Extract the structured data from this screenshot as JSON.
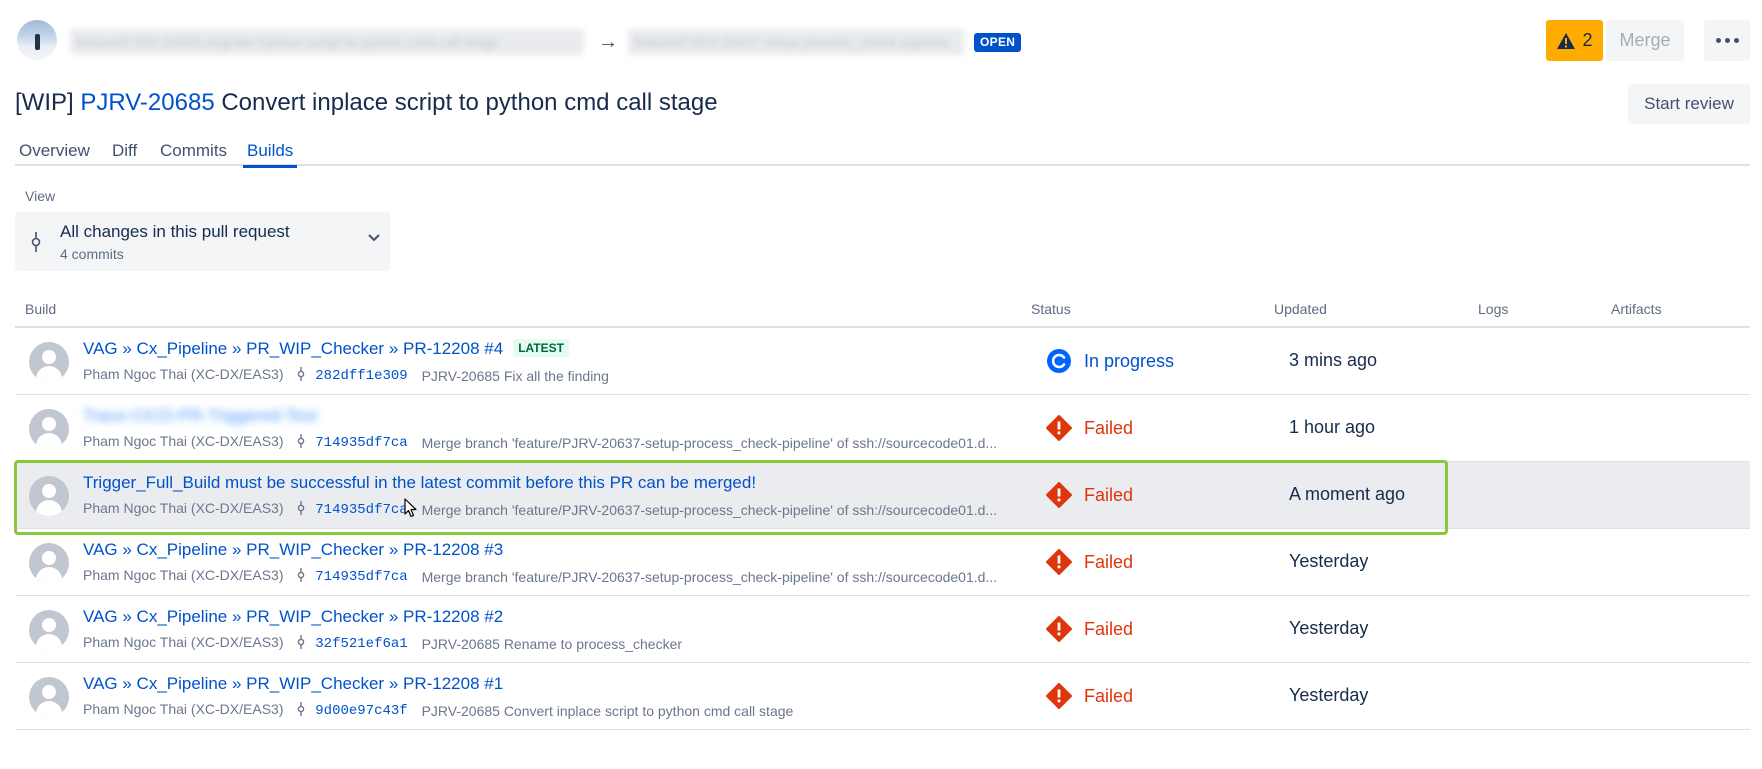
{
  "header": {
    "source_branch": "feature/PJRV-20685-migrate-inplace-script-to-python-cmd-call-stage",
    "dest_branch": "feature/PJRV-20637-setup-process_check-pipeline",
    "arrow": "→",
    "state_badge": "OPEN",
    "warning_count": "2",
    "merge_label": "Merge",
    "more_label": "•••"
  },
  "pr": {
    "prefix": "[WIP]",
    "issue_key": "PJRV-20685",
    "title": "Convert inplace script to python cmd call stage",
    "start_review_label": "Start review"
  },
  "tabs": [
    {
      "label": "Overview"
    },
    {
      "label": "Diff"
    },
    {
      "label": "Commits"
    },
    {
      "label": "Builds"
    }
  ],
  "view": {
    "label": "View",
    "selected": "All changes in this pull request",
    "subtext": "4 commits"
  },
  "table": {
    "columns": [
      "Build",
      "Status",
      "Updated",
      "Logs",
      "Artifacts"
    ],
    "rows": [
      {
        "name": "VAG » Cx_Pipeline » PR_WIP_Checker » PR-12208 #4",
        "badge": "LATEST",
        "author": "Pham Ngoc Thai (XC-DX/EAS3)",
        "hash": "282dff1e309",
        "message": "PJRV-20685 Fix all the finding",
        "status": "In progress",
        "updated": "3 mins ago"
      },
      {
        "name": "Trace-CICD-PR-Triggered-Test",
        "badge": "",
        "author": "Pham Ngoc Thai (XC-DX/EAS3)",
        "hash": "714935df7ca",
        "message": "Merge branch 'feature/PJRV-20637-setup-process_check-pipeline' of ssh://sourcecode01.d...",
        "status": "Failed",
        "updated": "1 hour ago"
      },
      {
        "name": "Trigger_Full_Build must be successful in the latest commit before this PR can be merged!",
        "badge": "",
        "author": "Pham Ngoc Thai (XC-DX/EAS3)",
        "hash": "714935df7ca",
        "message": "Merge branch 'feature/PJRV-20637-setup-process_check-pipeline' of ssh://sourcecode01.d...",
        "status": "Failed",
        "updated": "A moment ago"
      },
      {
        "name": "VAG » Cx_Pipeline » PR_WIP_Checker » PR-12208 #3",
        "badge": "",
        "author": "Pham Ngoc Thai (XC-DX/EAS3)",
        "hash": "714935df7ca",
        "message": "Merge branch 'feature/PJRV-20637-setup-process_check-pipeline' of ssh://sourcecode01.d...",
        "status": "Failed",
        "updated": "Yesterday"
      },
      {
        "name": "VAG » Cx_Pipeline » PR_WIP_Checker » PR-12208 #2",
        "badge": "",
        "author": "Pham Ngoc Thai (XC-DX/EAS3)",
        "hash": "32f521ef6a1",
        "message": "PJRV-20685 Rename to process_checker",
        "status": "Failed",
        "updated": "Yesterday"
      },
      {
        "name": "VAG » Cx_Pipeline » PR_WIP_Checker » PR-12208 #1",
        "badge": "",
        "author": "Pham Ngoc Thai (XC-DX/EAS3)",
        "hash": "9d00e97c43f",
        "message": "PJRV-20685 Convert inplace script to python cmd call stage",
        "status": "Failed",
        "updated": "Yesterday"
      }
    ]
  },
  "colors": {
    "link": "#0052cc",
    "failed": "#de350b",
    "warning": "#ffab00",
    "highlight_frame": "#8cc63f",
    "row_highlight": "#ebecf0"
  }
}
